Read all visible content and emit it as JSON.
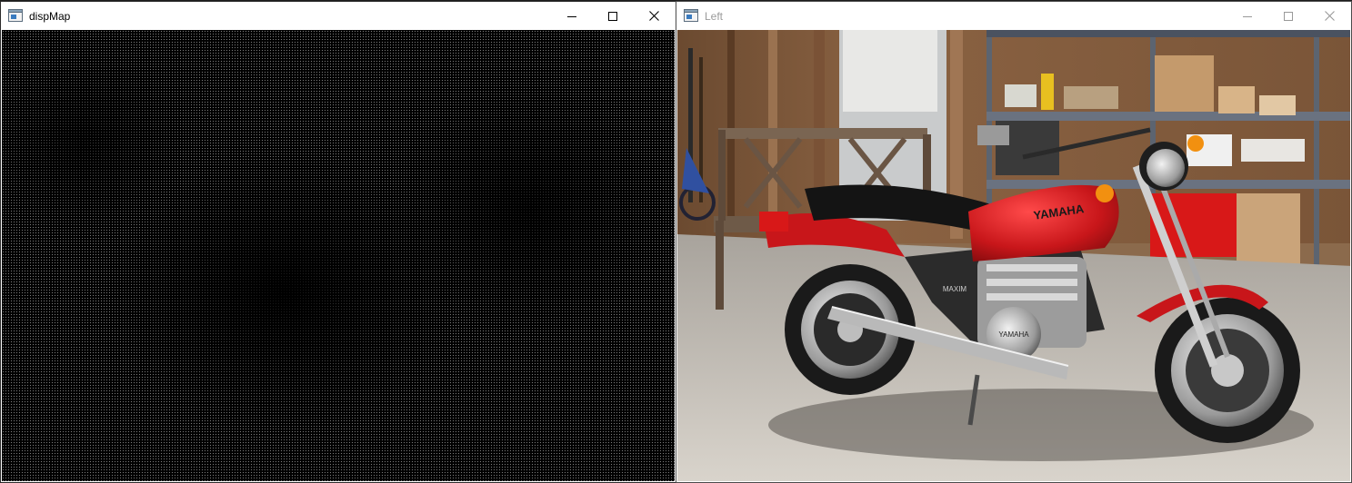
{
  "windows": {
    "disparity": {
      "title": "dispMap",
      "controls": {
        "minimize": "minimize-icon",
        "maximize": "maximize-icon",
        "close": "close-icon"
      }
    },
    "left": {
      "title": "Left",
      "controls": {
        "minimize": "minimize-icon",
        "maximize": "maximize-icon",
        "close": "close-icon"
      },
      "image_subject": "Red motorcycle in garage",
      "bike_tank_label": "YAMAHA",
      "bike_side_label": "MAXIM",
      "engine_cover_label": "YAMAHA"
    }
  },
  "colors": {
    "titlebar": "#ffffff",
    "active_title_text": "#000000",
    "inactive_title_text": "#9a9a9a",
    "disparity_background": "#000000",
    "bike_red": "#c8161a"
  }
}
